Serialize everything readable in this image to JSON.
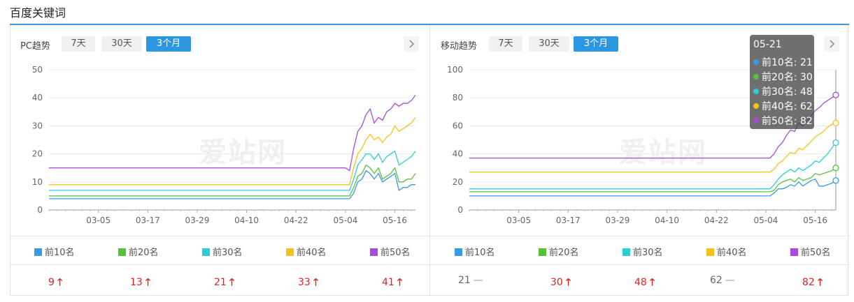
{
  "page": {
    "title": "百度关键词"
  },
  "colors": {
    "accent": "#2d96e1",
    "top10": "#3a99e0",
    "top20": "#56c23a",
    "top30": "#2ccdd6",
    "top40": "#f7c21c",
    "top50": "#a64cdc",
    "up": "#e02020"
  },
  "range_buttons": [
    "7天",
    "30天",
    "3个月"
  ],
  "active_range": "3个月",
  "watermark": "爱站网",
  "legend_labels": [
    "前10名",
    "前20名",
    "前30名",
    "前40名",
    "前50名"
  ],
  "pc": {
    "title": "PC趋势",
    "values": [
      {
        "value": "9",
        "trend": "up"
      },
      {
        "value": "13",
        "trend": "up"
      },
      {
        "value": "21",
        "trend": "up"
      },
      {
        "value": "33",
        "trend": "up"
      },
      {
        "value": "41",
        "trend": "up"
      }
    ]
  },
  "mobile": {
    "title": "移动趋势",
    "values": [
      {
        "value": "21",
        "trend": "flat"
      },
      {
        "value": "30",
        "trend": "up"
      },
      {
        "value": "48",
        "trend": "up"
      },
      {
        "value": "62",
        "trend": "flat"
      },
      {
        "value": "82",
        "trend": "up"
      }
    ],
    "tooltip": {
      "date": "05-21",
      "rows": [
        "前10名: 21",
        "前20名: 30",
        "前30名: 48",
        "前40名: 62",
        "前50名: 82"
      ]
    }
  },
  "chart_data": [
    {
      "type": "line",
      "title": "PC趋势",
      "xlabel": "",
      "ylabel": "",
      "ylim": [
        0,
        50
      ],
      "yticks": [
        0,
        10,
        20,
        30,
        40,
        50
      ],
      "xlim": [
        "02-21",
        "05-21"
      ],
      "xtick_labels": [
        "03-05",
        "03-17",
        "03-29",
        "04-10",
        "04-22",
        "05-04",
        "05-16"
      ],
      "x": [
        "05-04",
        "05-05",
        "05-06",
        "05-07",
        "05-08",
        "05-09",
        "05-10",
        "05-11",
        "05-12",
        "05-13",
        "05-14",
        "05-15",
        "05-16",
        "05-17",
        "05-18",
        "05-19",
        "05-20",
        "05-21"
      ],
      "baseline_from": "02-21",
      "series": [
        {
          "name": "前10名",
          "baseline": 4,
          "values": [
            4,
            4,
            6,
            10,
            11,
            14,
            13,
            11,
            13,
            10,
            11,
            12,
            13,
            7,
            8,
            8,
            9,
            9
          ]
        },
        {
          "name": "前20名",
          "baseline": 5,
          "values": [
            5,
            5,
            8,
            12,
            13,
            16,
            15,
            13,
            15,
            11,
            12,
            13,
            15,
            10,
            10,
            11,
            11,
            13
          ]
        },
        {
          "name": "前30名",
          "baseline": 7,
          "values": [
            7,
            7,
            11,
            16,
            18,
            20,
            20,
            18,
            20,
            17,
            19,
            20,
            21,
            16,
            17,
            18,
            19,
            21
          ]
        },
        {
          "name": "前40名",
          "baseline": 9,
          "values": [
            9,
            9,
            15,
            20,
            22,
            25,
            27,
            25,
            26,
            24,
            26,
            27,
            30,
            28,
            29,
            30,
            31,
            33
          ]
        },
        {
          "name": "前50名",
          "baseline": 15,
          "values": [
            15,
            14,
            22,
            28,
            30,
            34,
            36,
            31,
            33,
            32,
            35,
            36,
            38,
            37,
            38,
            38,
            39,
            41
          ]
        }
      ],
      "grid": true,
      "legend": "bottom"
    },
    {
      "type": "line",
      "title": "移动趋势",
      "xlabel": "",
      "ylabel": "",
      "ylim": [
        0,
        100
      ],
      "yticks": [
        0,
        20,
        40,
        60,
        80,
        100
      ],
      "xlim": [
        "02-21",
        "05-21"
      ],
      "xtick_labels": [
        "03-05",
        "03-17",
        "03-29",
        "04-10",
        "04-22",
        "05-04",
        "05-16"
      ],
      "x": [
        "05-04",
        "05-05",
        "05-06",
        "05-07",
        "05-08",
        "05-09",
        "05-10",
        "05-11",
        "05-12",
        "05-13",
        "05-14",
        "05-15",
        "05-16",
        "05-17",
        "05-18",
        "05-19",
        "05-20",
        "05-21"
      ],
      "baseline_from": "02-21",
      "series": [
        {
          "name": "前10名",
          "baseline": 10,
          "values": [
            10,
            10,
            12,
            15,
            15,
            16,
            18,
            17,
            20,
            17,
            19,
            21,
            22,
            17,
            17,
            18,
            19,
            21
          ]
        },
        {
          "name": "前20名",
          "baseline": 13,
          "values": [
            13,
            13,
            14,
            18,
            20,
            21,
            22,
            20,
            23,
            21,
            22,
            23,
            26,
            25,
            26,
            27,
            28,
            30
          ]
        },
        {
          "name": "前30名",
          "baseline": 15,
          "values": [
            15,
            15,
            18,
            22,
            25,
            27,
            29,
            27,
            30,
            28,
            30,
            32,
            35,
            34,
            37,
            40,
            44,
            48
          ]
        },
        {
          "name": "前40名",
          "baseline": 27,
          "values": [
            27,
            27,
            29,
            33,
            35,
            38,
            41,
            40,
            44,
            43,
            46,
            49,
            52,
            54,
            56,
            59,
            61,
            62
          ]
        },
        {
          "name": "前50名",
          "baseline": 37,
          "values": [
            37,
            37,
            40,
            45,
            48,
            53,
            57,
            56,
            62,
            60,
            64,
            67,
            71,
            73,
            76,
            78,
            80,
            82
          ]
        }
      ],
      "grid": true,
      "legend": "bottom",
      "highlight_x": "05-21"
    }
  ]
}
